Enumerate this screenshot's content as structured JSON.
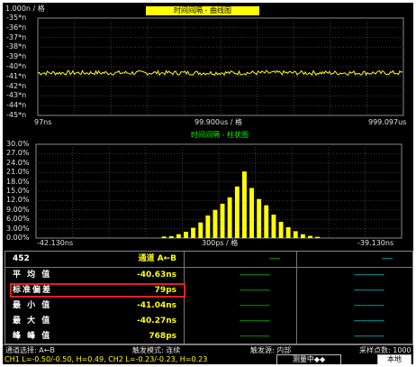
{
  "top_chart": {
    "unit_label": "1.000n / 格",
    "title": "时间间隔 - 曲线图",
    "y_ticks": [
      "-35*n",
      "-36*n",
      "-37*n",
      "-38*n",
      "-39*n",
      "-40*n",
      "-41*n",
      "-42*n",
      "-43*n",
      "-44*n",
      "-45*n"
    ],
    "x_left": "97ns",
    "x_center": "99.900us / 格",
    "x_right": "999.097us",
    "line_color": "#ffff00"
  },
  "bottom_chart": {
    "title": "时间间隔 - 柱状图",
    "y_ticks": [
      "30.0%",
      "27.0%",
      "24.0%",
      "21.0%",
      "18.0%",
      "15.0%",
      "12.0%",
      "9.00%",
      "6.00%",
      "3.00%",
      "0.00%"
    ],
    "x_left": "-42.130ns",
    "x_center": "300ps / 格",
    "x_right": "-39.130ns",
    "bar_color": "#ffff00"
  },
  "chart_data": {
    "type": "bar",
    "title": "时间间隔 - 柱状图",
    "xlabel": "300ps / 格",
    "ylabel": "",
    "x_range": [
      "-42.130ns",
      "-39.130ns"
    ],
    "ylim": [
      0,
      30
    ],
    "categories": [
      "-41.08",
      "-41.02",
      "-40.96",
      "-40.90",
      "-40.84",
      "-40.78",
      "-40.72",
      "-40.66",
      "-40.60",
      "-40.54",
      "-40.48",
      "-40.42",
      "-40.36",
      "-40.30",
      "-40.24",
      "-40.18",
      "-40.12",
      "-40.06",
      "-40.00",
      "-39.94",
      "-39.88",
      "-39.82"
    ],
    "values": [
      0.5,
      0.6,
      1.2,
      2.0,
      3.3,
      5.0,
      7.2,
      9.0,
      11.0,
      13.0,
      16.5,
      21.3,
      16.0,
      12.5,
      10.5,
      7.5,
      5.2,
      3.5,
      2.2,
      1.2,
      0.7,
      0.4
    ]
  },
  "stats": {
    "count": "452",
    "channel_header": "通道 A←B",
    "rows": [
      {
        "label": "平 均 值",
        "value": "-40.63ns"
      },
      {
        "label": "标准偏差",
        "value": "79ps"
      },
      {
        "label": "最 小 值",
        "value": "-41.04ns"
      },
      {
        "label": "最 大 值",
        "value": "-40.27ns"
      },
      {
        "label": "峰 峰 值",
        "value": "768ps"
      }
    ],
    "dash_header_green": "-----",
    "dash_header_cyan": "-----",
    "dash_green": "--------------",
    "dash_cyan": "--------------"
  },
  "status": {
    "channel_select": "通道选择: A←B",
    "trigger_mode": "触发模式: 连续",
    "trigger_source": "触发源: 内部",
    "sample_points": "采样点数: 1000",
    "ch_levels": "CH1 L=-0.50/-0.50, H=0.49, CH2 L=-0.23/-0.23, H=0.23",
    "measuring": "测量中◆◆",
    "local": "本地"
  }
}
